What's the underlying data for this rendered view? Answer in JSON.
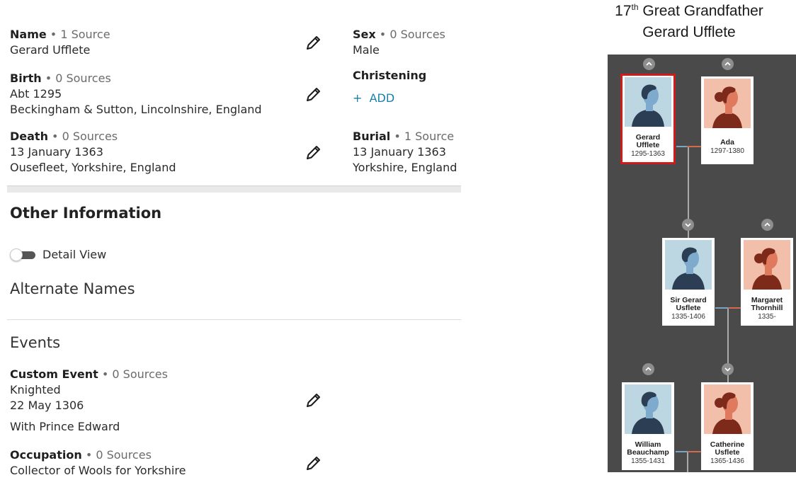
{
  "facts": {
    "name": {
      "label": "Name",
      "sources": "1 Source",
      "lines": [
        "Gerard Ufflete"
      ]
    },
    "birth": {
      "label": "Birth",
      "sources": "0 Sources",
      "lines": [
        "Abt 1295",
        "Beckingham & Sutton, Lincolnshire, England"
      ]
    },
    "death": {
      "label": "Death",
      "sources": "0 Sources",
      "lines": [
        "13 January 1363",
        "Ousefleet, Yorkshire, England"
      ]
    },
    "sex": {
      "label": "Sex",
      "sources": "0 Sources",
      "lines": [
        "Male"
      ]
    },
    "christening": {
      "label": "Christening",
      "add": "+  ADD"
    },
    "burial": {
      "label": "Burial",
      "sources": "1 Source",
      "lines": [
        "13 January 1363",
        "Yorkshire, England"
      ]
    }
  },
  "other_info": {
    "title": "Other Information",
    "toggle_label": "Detail View",
    "alt_names_title": "Alternate Names",
    "events_title": "Events",
    "custom_event": {
      "label": "Custom Event",
      "sources": "0 Sources",
      "lines": [
        "Knighted",
        "22 May 1306"
      ],
      "description": "With Prince Edward"
    },
    "occupation": {
      "label": "Occupation",
      "sources": "0 Sources",
      "lines": [
        "Collector of Wools for Yorkshire"
      ]
    }
  },
  "relationship": {
    "ordinal": "17",
    "ordinal_suffix": "th",
    "title_rest": " Great Grandfather",
    "person": "Gerard Ufflete"
  },
  "tree": {
    "cards": [
      {
        "id": "gerard",
        "name_lines": [
          "Gerard",
          "Ufflete"
        ],
        "years": "1295-1363",
        "gender": "male",
        "selected": true
      },
      {
        "id": "ada",
        "name_lines": [
          "Ada"
        ],
        "years": "1297-1380",
        "gender": "female",
        "selected": false
      },
      {
        "id": "sir-gerard",
        "name_lines": [
          "Sir Gerard",
          "Usflete"
        ],
        "years": "1335-1406",
        "gender": "male",
        "selected": false
      },
      {
        "id": "margaret",
        "name_lines": [
          "Margaret",
          "Thornhill"
        ],
        "years": "1335-",
        "gender": "female",
        "selected": false
      },
      {
        "id": "william",
        "name_lines": [
          "William",
          "Beauchamp"
        ],
        "years": "1355-1431",
        "gender": "male",
        "selected": false
      },
      {
        "id": "catherine",
        "name_lines": [
          "Catherine",
          "Usflete"
        ],
        "years": "1365-1436",
        "gender": "female",
        "selected": false
      }
    ]
  },
  "colors": {
    "link": "#1a7fa8",
    "tree_bg": "#4a4a4a",
    "selected_border": "#d11a1a",
    "male_bg": "#bcd6e2",
    "male_skin": "#7eaacd",
    "male_hair": "#2c3e54",
    "female_bg": "#f2c0aa",
    "female_skin": "#e07a5e",
    "female_hair": "#7e2a1a"
  },
  "icons": {
    "edit": "pencil-icon",
    "expand_up": "chevron-up-icon",
    "expand_down": "chevron-down-icon"
  }
}
